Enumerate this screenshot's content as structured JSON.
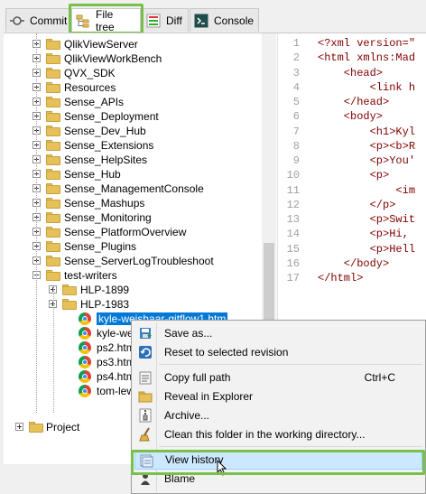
{
  "tabs": [
    {
      "label": "Commit",
      "icon": "commit-icon"
    },
    {
      "label": "File tree",
      "icon": "file-tree-icon",
      "active": true
    },
    {
      "label": "Diff",
      "icon": "diff-icon"
    },
    {
      "label": "Console",
      "icon": "console-icon"
    }
  ],
  "tree": {
    "items": [
      {
        "label": "QlikViewServer",
        "type": "folder",
        "expander": "plus"
      },
      {
        "label": "QlikViewWorkBench",
        "type": "folder",
        "expander": "plus"
      },
      {
        "label": "QVX_SDK",
        "type": "folder",
        "expander": "plus"
      },
      {
        "label": "Resources",
        "type": "folder",
        "expander": "plus"
      },
      {
        "label": "Sense_APIs",
        "type": "folder",
        "expander": "plus"
      },
      {
        "label": "Sense_Deployment",
        "type": "folder",
        "expander": "plus"
      },
      {
        "label": "Sense_Dev_Hub",
        "type": "folder",
        "expander": "plus"
      },
      {
        "label": "Sense_Extensions",
        "type": "folder",
        "expander": "plus"
      },
      {
        "label": "Sense_HelpSites",
        "type": "folder",
        "expander": "plus"
      },
      {
        "label": "Sense_Hub",
        "type": "folder",
        "expander": "plus"
      },
      {
        "label": "Sense_ManagementConsole",
        "type": "folder",
        "expander": "plus"
      },
      {
        "label": "Sense_Mashups",
        "type": "folder",
        "expander": "plus"
      },
      {
        "label": "Sense_Monitoring",
        "type": "folder",
        "expander": "plus"
      },
      {
        "label": "Sense_PlatformOverview",
        "type": "folder",
        "expander": "plus"
      },
      {
        "label": "Sense_Plugins",
        "type": "folder",
        "expander": "plus"
      },
      {
        "label": "Sense_ServerLogTroubleshoot",
        "type": "folder",
        "expander": "plus"
      },
      {
        "label": "test-writers",
        "type": "folder",
        "expander": "minus"
      },
      {
        "label": "HLP-1899",
        "type": "folder",
        "expander": "plus",
        "indent": 1
      },
      {
        "label": "HLP-1983",
        "type": "folder",
        "expander": "plus",
        "indent": 1
      },
      {
        "label": "kyle-weishaar-gitflow1.htm",
        "type": "file",
        "indent": 1,
        "selected": true
      },
      {
        "label": "kyle-weisha",
        "type": "file",
        "indent": 1
      },
      {
        "label": "ps2.htm",
        "type": "file",
        "indent": 1
      },
      {
        "label": "ps3.htm",
        "type": "file",
        "indent": 1
      },
      {
        "label": "ps4.htm",
        "type": "file",
        "indent": 1
      },
      {
        "label": "tom-lewis-te",
        "type": "file",
        "indent": 1
      }
    ],
    "project_label": "Project"
  },
  "code": {
    "line_numbers": [
      "1",
      "2",
      "3",
      "4",
      "5",
      "6",
      "7",
      "8",
      "9",
      "10",
      "11",
      "12",
      "13",
      "14",
      "15",
      "16",
      "17"
    ],
    "lines": [
      "<?xml version=\"",
      "<html xmlns:Mad",
      "    <head>",
      "        <link h",
      "    </head>",
      "    <body>",
      "        <h1>Kyl",
      "        <p><b>R",
      "        <p>You'",
      "        <p>",
      "            <im",
      "        </p>",
      "        <p>Swit",
      "        <p>Hi,",
      "        <p>Hell",
      "    </body>",
      "</html>"
    ]
  },
  "context_menu": {
    "items": [
      {
        "label": "Save as...",
        "icon": "save-as-icon"
      },
      {
        "label": "Reset to selected revision",
        "icon": "reset-icon"
      },
      {
        "separator": true
      },
      {
        "label": "Copy full path",
        "shortcut": "Ctrl+C",
        "icon": "copy-icon"
      },
      {
        "label": "Reveal in Explorer",
        "icon": "folder-icon"
      },
      {
        "label": "Archive...",
        "icon": "archive-icon"
      },
      {
        "label": "Clean this folder in the working directory...",
        "icon": "clean-icon"
      },
      {
        "separator": true
      },
      {
        "label": "View history",
        "icon": "history-icon",
        "hover": true
      },
      {
        "label": "Blame",
        "icon": "blame-icon"
      }
    ]
  },
  "colors": {
    "highlight": "#79c04a",
    "selection": "#0078d7",
    "code_tag": "#800000",
    "code_attr": "#ff0000"
  }
}
